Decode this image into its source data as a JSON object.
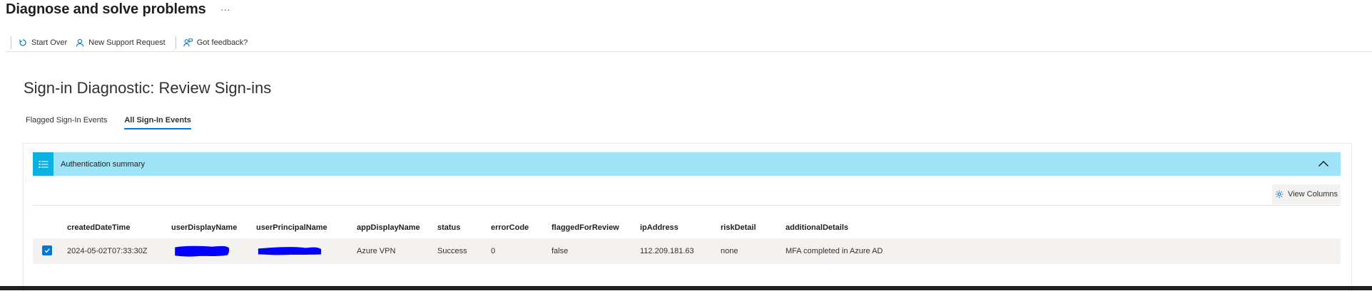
{
  "header": {
    "title": "Diagnose and solve problems",
    "more": "···"
  },
  "commandBar": {
    "startOver": "Start Over",
    "newSupportRequest": "New Support Request",
    "feedback": "Got feedback?"
  },
  "sectionTitle": "Sign-in Diagnostic: Review Sign-ins",
  "tabs": [
    {
      "label": "Flagged Sign-In Events",
      "active": false
    },
    {
      "label": "All Sign-In Events",
      "active": true
    }
  ],
  "accordion": {
    "label": "Authentication summary"
  },
  "viewColumns": "View Columns",
  "table": {
    "columns": [
      "createdDateTime",
      "userDisplayName",
      "userPrincipalName",
      "appDisplayName",
      "status",
      "errorCode",
      "flaggedForReview",
      "ipAddress",
      "riskDetail",
      "additionalDetails"
    ],
    "rows": [
      {
        "createdDateTime": "2024-05-02T07:33:30Z",
        "userDisplayName": "",
        "userPrincipalName": "",
        "appDisplayName": "Azure VPN",
        "status": "Success",
        "errorCode": "0",
        "flaggedForReview": "false",
        "ipAddress": "112.209.181.63",
        "riskDetail": "none",
        "additionalDetails": "MFA completed in Azure AD",
        "selected": true
      }
    ]
  },
  "colors": {
    "accent": "#0078d4",
    "accordionBg": "#9fe4f6",
    "accordionIcon": "#0ab2e2",
    "redaction": "#0000ff",
    "rowBg": "#f3f2f1"
  }
}
